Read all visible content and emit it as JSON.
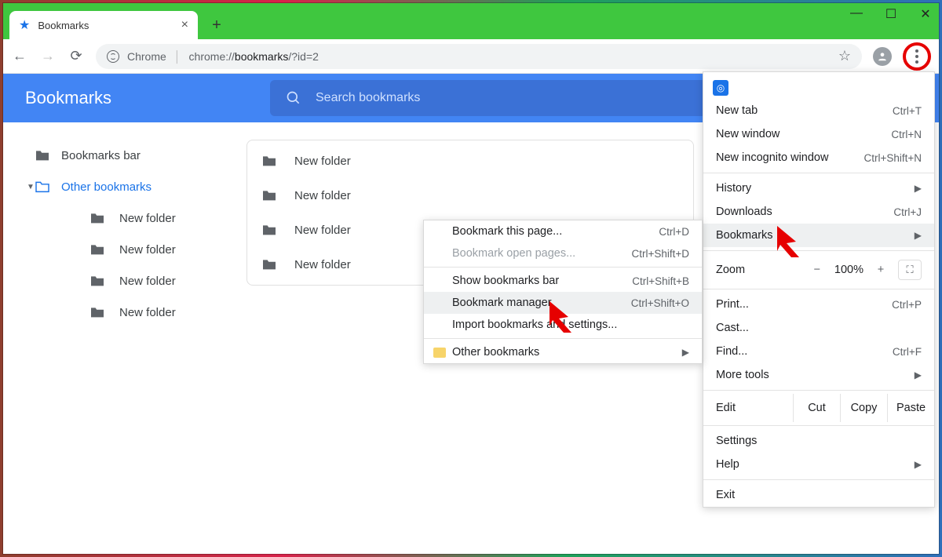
{
  "tab": {
    "title": "Bookmarks"
  },
  "address": {
    "scheme": "Chrome",
    "prefix": "chrome://",
    "bold": "bookmarks",
    "suffix": "/?id=2"
  },
  "page": {
    "title": "Bookmarks",
    "search_placeholder": "Search bookmarks"
  },
  "sidebar": {
    "items": [
      {
        "label": "Bookmarks bar"
      },
      {
        "label": "Other bookmarks"
      },
      {
        "label": "New folder"
      },
      {
        "label": "New folder"
      },
      {
        "label": "New folder"
      },
      {
        "label": "New folder"
      }
    ]
  },
  "list": {
    "rows": [
      {
        "label": "New folder"
      },
      {
        "label": "New folder"
      },
      {
        "label": "New folder"
      },
      {
        "label": "New folder"
      }
    ]
  },
  "menu": {
    "newtab": {
      "label": "New tab",
      "shortcut": "Ctrl+T"
    },
    "newwindow": {
      "label": "New window",
      "shortcut": "Ctrl+N"
    },
    "incognito": {
      "label": "New incognito window",
      "shortcut": "Ctrl+Shift+N"
    },
    "history": {
      "label": "History"
    },
    "downloads": {
      "label": "Downloads",
      "shortcut": "Ctrl+J"
    },
    "bookmarks": {
      "label": "Bookmarks"
    },
    "zoom": {
      "label": "Zoom",
      "value": "100%",
      "minus": "−",
      "plus": "+"
    },
    "print": {
      "label": "Print...",
      "shortcut": "Ctrl+P"
    },
    "cast": {
      "label": "Cast..."
    },
    "find": {
      "label": "Find...",
      "shortcut": "Ctrl+F"
    },
    "moretools": {
      "label": "More tools"
    },
    "edit": {
      "label": "Edit",
      "cut": "Cut",
      "copy": "Copy",
      "paste": "Paste"
    },
    "settings": {
      "label": "Settings"
    },
    "help": {
      "label": "Help"
    },
    "exit": {
      "label": "Exit"
    }
  },
  "submenu": {
    "bookmarkpage": {
      "label": "Bookmark this page...",
      "shortcut": "Ctrl+D"
    },
    "bookmarkopen": {
      "label": "Bookmark open pages...",
      "shortcut": "Ctrl+Shift+D"
    },
    "showbar": {
      "label": "Show bookmarks bar",
      "shortcut": "Ctrl+Shift+B"
    },
    "manager": {
      "label": "Bookmark manager",
      "shortcut": "Ctrl+Shift+O"
    },
    "import": {
      "label": "Import bookmarks and settings..."
    },
    "other": {
      "label": "Other bookmarks"
    }
  }
}
